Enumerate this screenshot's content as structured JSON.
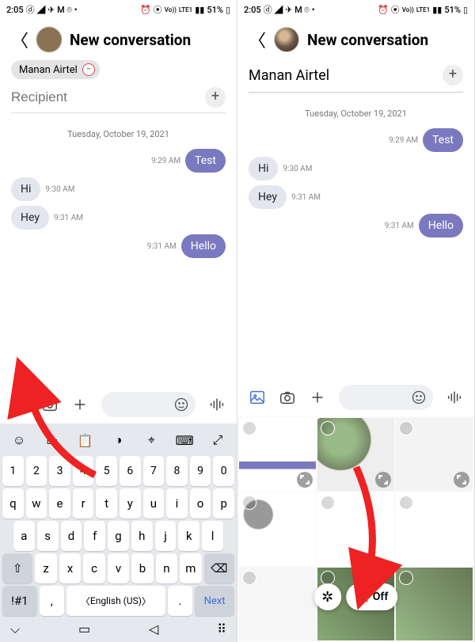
{
  "status": {
    "time": "2:05",
    "battery": "51%",
    "network": "LTE1",
    "vo": "Vo))"
  },
  "header": {
    "title": "New conversation"
  },
  "recipient": {
    "chip": "Manan Airtel",
    "placeholder": "Recipient",
    "name_display": "Manan Airtel"
  },
  "date_label": "Tuesday, October 19, 2021",
  "messages": [
    {
      "dir": "out",
      "text": "Test",
      "time": "9:29 AM"
    },
    {
      "dir": "in",
      "text": "Hi",
      "time": "9:30 AM"
    },
    {
      "dir": "in",
      "text": "Hey",
      "time": "9:31 AM"
    },
    {
      "dir": "out",
      "text": "Hello",
      "time": "9:31 AM"
    }
  ],
  "keyboard": {
    "row_num": [
      "1",
      "2",
      "3",
      "4",
      "5",
      "6",
      "7",
      "8",
      "9",
      "0"
    ],
    "row_top": [
      "q",
      "w",
      "e",
      "r",
      "t",
      "y",
      "u",
      "i",
      "o",
      "p"
    ],
    "row_mid": [
      "a",
      "s",
      "d",
      "f",
      "g",
      "h",
      "j",
      "k",
      "l"
    ],
    "row_bot_letters": [
      "z",
      "x",
      "c",
      "v",
      "b",
      "n",
      "m"
    ],
    "symkey": "!#1",
    "comma": ",",
    "lang": "English (US)",
    "period": ".",
    "next": "Next"
  },
  "picker": {
    "off_label": "Off"
  }
}
